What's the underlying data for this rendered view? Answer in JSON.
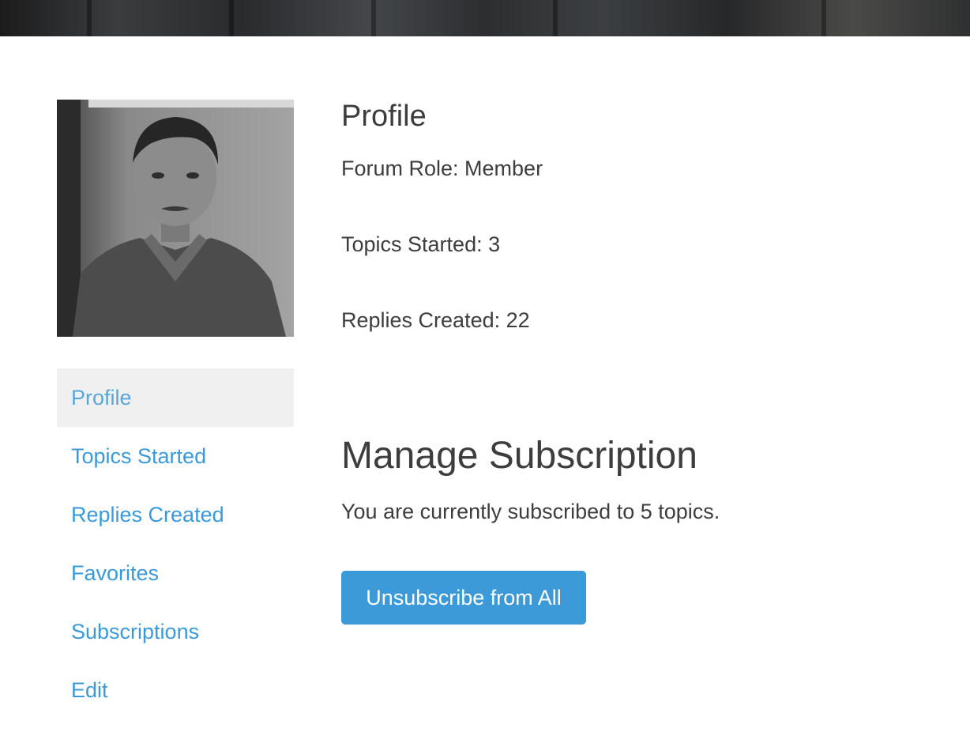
{
  "sidebar": {
    "items": [
      {
        "label": "Profile",
        "active": true
      },
      {
        "label": "Topics Started",
        "active": false
      },
      {
        "label": "Replies Created",
        "active": false
      },
      {
        "label": "Favorites",
        "active": false
      },
      {
        "label": "Subscriptions",
        "active": false
      },
      {
        "label": "Edit",
        "active": false
      }
    ]
  },
  "profile": {
    "heading": "Profile",
    "forum_role": "Forum Role: Member",
    "topics_started": "Topics Started: 3",
    "replies_created": "Replies Created: 22"
  },
  "subscription": {
    "heading": "Manage Subscription",
    "note": "You are currently subscribed to 5 topics.",
    "button_label": "Unsubscribe from All"
  },
  "colors": {
    "link": "#3a9ad9",
    "button": "#3d9ad9",
    "active_bg": "#f0f0f0",
    "text": "#3d3d3d"
  }
}
